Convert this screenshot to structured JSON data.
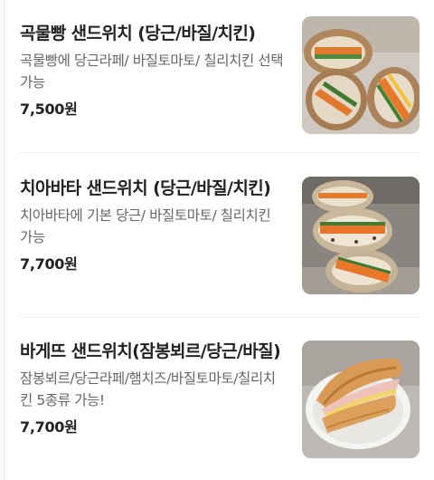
{
  "menu": {
    "items": [
      {
        "name": "곡물빵 샌드위치 (당근/바질/치킨)",
        "description": "곡물빵에 당근라페/ 바질토마토/ 칠리치킨 선택가능",
        "price": "7,500원"
      },
      {
        "name": "치아바타 샌드위치 (당근/바질/치킨)",
        "description": "치아바타에 기본 당근/ 바질토마토/ 칠리치킨 가능",
        "price": "7,700원"
      },
      {
        "name": "바게뜨 샌드위치(잠봉뵈르/당근/바질)",
        "description": "잠봉뵈르/당근라페/햄치즈/바질토마토/칠리치킨 5종류 가능!",
        "price": "7,700원"
      }
    ]
  }
}
